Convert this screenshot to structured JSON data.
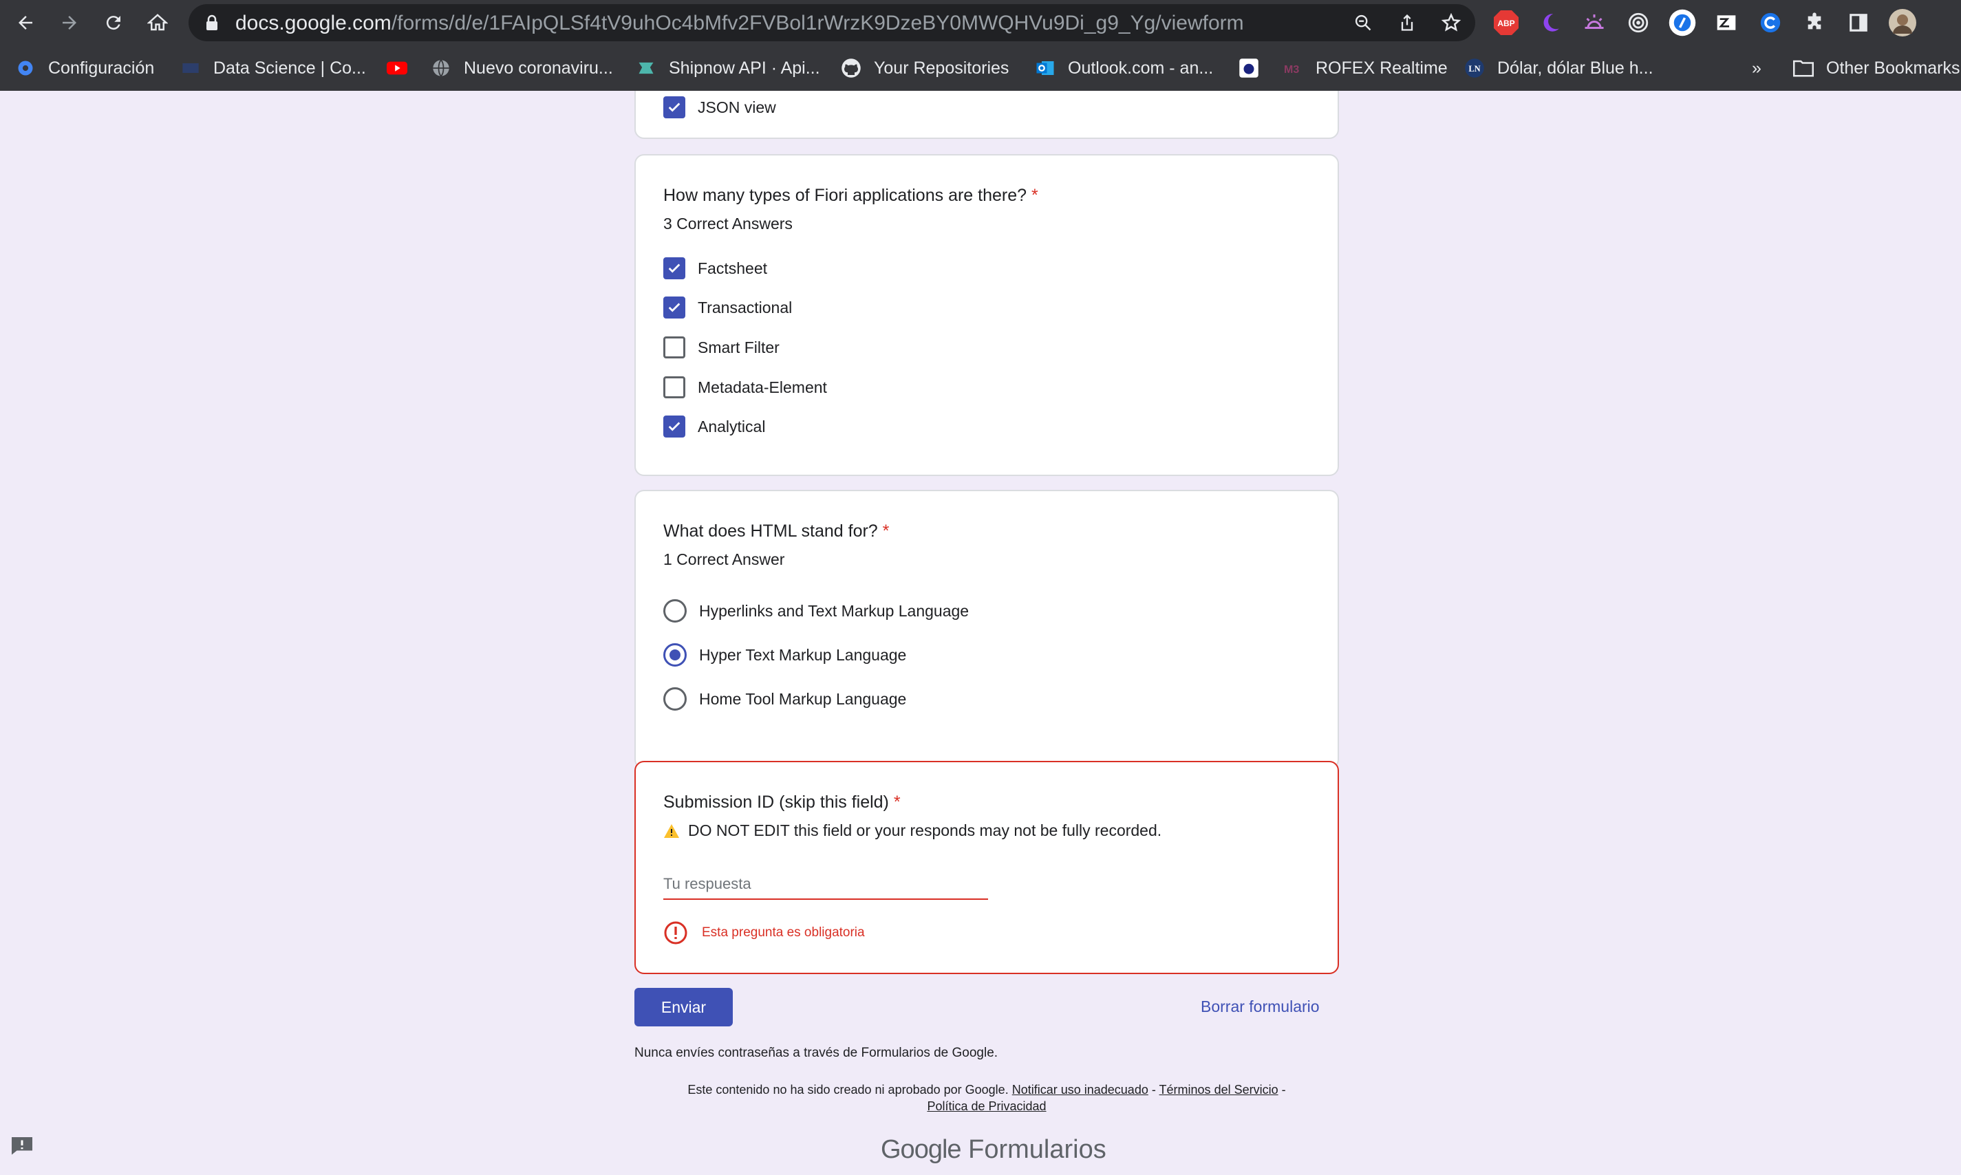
{
  "browser": {
    "url_host": "docs.google.com",
    "url_path": "/forms/d/e/1FAIpQLSf4tV9uhOc4bMfv2FVBol1rWrzK9DzeBY0MWQHVu9Di_g9_Yg/viewform",
    "extensions": {
      "abp": "ABP"
    },
    "bookmarks": [
      {
        "label": "Configuración",
        "icon": "gear-icon"
      },
      {
        "label": "Data Science | Co...",
        "icon": "datascience-icon"
      },
      {
        "label": "",
        "icon": "youtube-icon"
      },
      {
        "label": "Nuevo coronaviru...",
        "icon": "globe-icon"
      },
      {
        "label": "Shipnow API · Api...",
        "icon": "shipnow-icon"
      },
      {
        "label": "Your Repositories",
        "icon": "github-icon"
      },
      {
        "label": "Outlook.com - an...",
        "icon": "outlook-icon"
      },
      {
        "label": "",
        "icon": "bookmark-logo-icon"
      },
      {
        "label": "ROFEX Realtime",
        "icon": "rofex-icon"
      },
      {
        "label": "Dólar, dólar Blue h...",
        "icon": "ln-icon"
      }
    ],
    "overflow": "»",
    "other_bookmarks": "Other Bookmarks"
  },
  "form": {
    "prev_option": {
      "label": "JSON view",
      "checked": true
    },
    "q_fiori": {
      "title": "How many types of Fiori applications are there?",
      "required": "*",
      "subtitle": "3 Correct Answers",
      "options": [
        {
          "label": "Factsheet",
          "checked": true
        },
        {
          "label": "Transactional",
          "checked": true
        },
        {
          "label": "Smart Filter",
          "checked": false
        },
        {
          "label": "Metadata-Element",
          "checked": false
        },
        {
          "label": "Analytical",
          "checked": true
        }
      ]
    },
    "q_html": {
      "title": "What does HTML stand for?",
      "required": "*",
      "subtitle": "1 Correct Answer",
      "options": [
        {
          "label": "Hyperlinks and Text Markup Language",
          "selected": false
        },
        {
          "label": "Hyper Text Markup Language",
          "selected": true
        },
        {
          "label": "Home Tool Markup Language",
          "selected": false
        }
      ]
    },
    "q_submission": {
      "title": "Submission ID (skip this field)",
      "required": "*",
      "warning": "DO NOT EDIT this field or your responds may not be fully recorded.",
      "placeholder": "Tu respuesta",
      "value": "",
      "error": "Esta pregunta es obligatoria"
    },
    "submit_label": "Enviar",
    "clear_label": "Borrar formulario",
    "password_note": "Nunca envíes contraseñas a través de Formularios de Google.",
    "footer_text": "Este contenido no ha sido creado ni aprobado por Google.",
    "footer_links": {
      "report": "Notificar uso inadecuado",
      "terms": "Términos del Servicio",
      "privacy": "Política de Privacidad"
    },
    "footer_sep": "-",
    "brand_google": "Google",
    "brand_product": "Formularios"
  },
  "colors": {
    "accent": "#3f51b5",
    "error": "#d93025",
    "page_bg": "#f0ebf8"
  }
}
